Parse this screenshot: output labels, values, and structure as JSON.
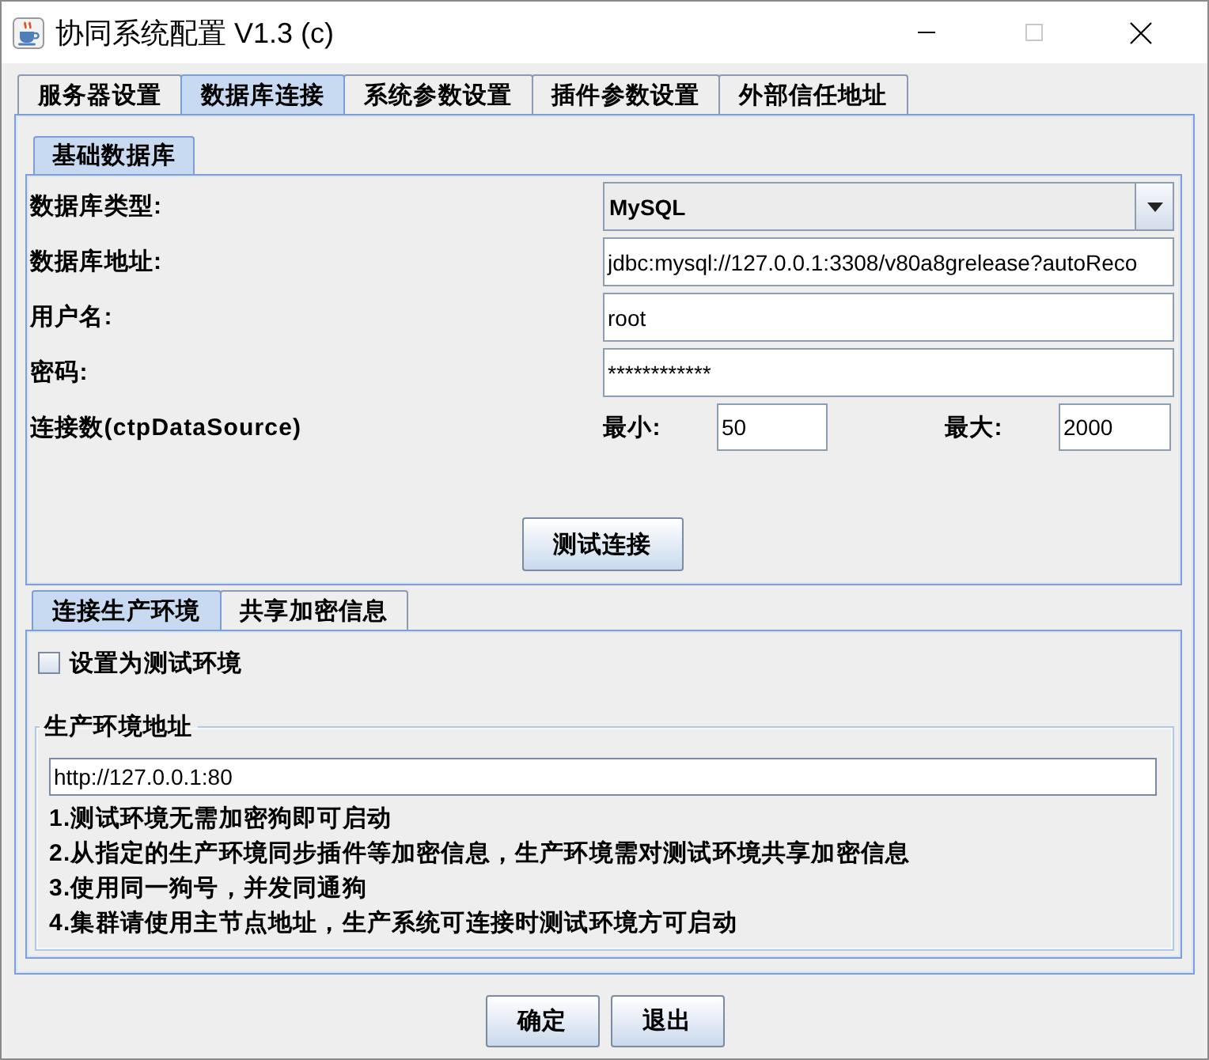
{
  "window": {
    "title": "协同系统配置 V1.3 (c)"
  },
  "tabs": [
    {
      "label": "服务器设置",
      "selected": false
    },
    {
      "label": "数据库连接",
      "selected": true
    },
    {
      "label": "系统参数设置",
      "selected": false
    },
    {
      "label": "插件参数设置",
      "selected": false
    },
    {
      "label": "外部信任地址",
      "selected": false
    }
  ],
  "database_tabs": [
    {
      "label": "基础数据库",
      "selected": true
    }
  ],
  "database_form": {
    "fields": [
      {
        "kind": "dropdown",
        "label": "数据库类型:",
        "value": "MySQL"
      },
      {
        "kind": "text",
        "label": "数据库地址:",
        "value": "jdbc:mysql://127.0.0.1:3308/v80a8grelease?autoReco"
      },
      {
        "kind": "text",
        "label": "用户名:",
        "value": "root"
      },
      {
        "kind": "text",
        "label": "密码:",
        "value": "************"
      }
    ],
    "connections": {
      "label": "连接数(ctpDataSource)",
      "min_label": "最小:",
      "min_value": "50",
      "max_label": "最大:",
      "max_value": "2000"
    },
    "test_button": "测试连接"
  },
  "environment_tabs": [
    {
      "label": "连接生产环境",
      "selected": true
    },
    {
      "label": "共享加密信息",
      "selected": false
    }
  ],
  "environment": {
    "test_checkbox": {
      "label": "设置为测试环境",
      "checked": false
    },
    "production_group": {
      "title": "生产环境地址",
      "address": "http://127.0.0.1:80",
      "notes": [
        "1.测试环境无需加密狗即可启动",
        "2.从指定的生产环境同步插件等加密信息，生产环境需对测试环境共享加密信息",
        "3.使用同一狗号，并发同通狗",
        "4.集群请使用主节点地址，生产系统可连接时测试环境方可启动"
      ]
    }
  },
  "buttons": [
    "确定",
    "退出"
  ]
}
